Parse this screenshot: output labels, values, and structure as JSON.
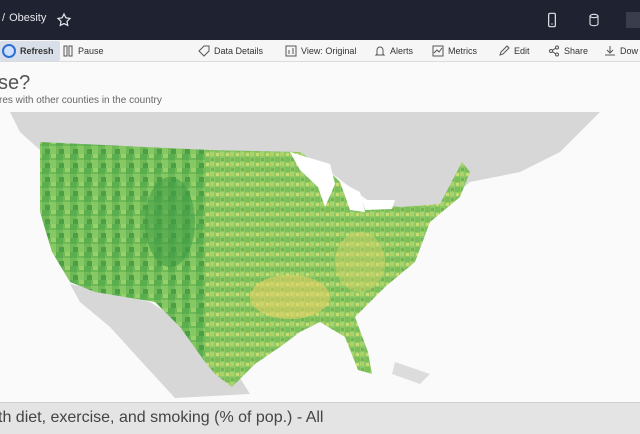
{
  "header": {
    "breadcrumb_sep": "/",
    "title": "Obesity",
    "icons": [
      "star-icon",
      "phone-icon",
      "database-icon"
    ]
  },
  "toolbar": {
    "refresh": "Refresh",
    "pause": "Pause",
    "data_details": "Data Details",
    "view": "View: Original",
    "alerts": "Alerts",
    "metrics": "Metrics",
    "edit": "Edit",
    "share": "Share",
    "download": "Dow"
  },
  "viz": {
    "title": "se?",
    "subtitle": "res with other counties in the country",
    "footer": "th diet, exercise, and smoking (% of pop.) - All"
  },
  "colors": {
    "titlebar": "#1f2230",
    "map_low": "#2e8b3e",
    "map_mid": "#7cc160",
    "map_high": "#f1d56a",
    "land_gray": "#d7d7d7"
  }
}
